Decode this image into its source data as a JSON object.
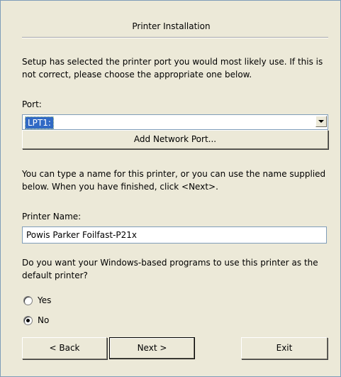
{
  "dialog": {
    "title": "Printer Installation",
    "intro_text": "Setup has selected the printer port you would most likely use. If this is not correct, please choose the appropriate one below.",
    "port_label": "Port:",
    "port_selected": "LPT1:",
    "add_network_port_label": "Add Network Port...",
    "name_instructions": "You can type a name for this printer, or you can use the name supplied below. When you have finished, click <Next>.",
    "printer_name_label": "Printer Name:",
    "printer_name_value": "Powis Parker Foilfast-P21x",
    "default_question": "Do you want your Windows-based programs to use this printer as the default printer?",
    "radio_yes": "Yes",
    "radio_no": "No",
    "selected_option": "No",
    "back_label": "< Back",
    "next_label": "Next >",
    "exit_label": "Exit"
  }
}
